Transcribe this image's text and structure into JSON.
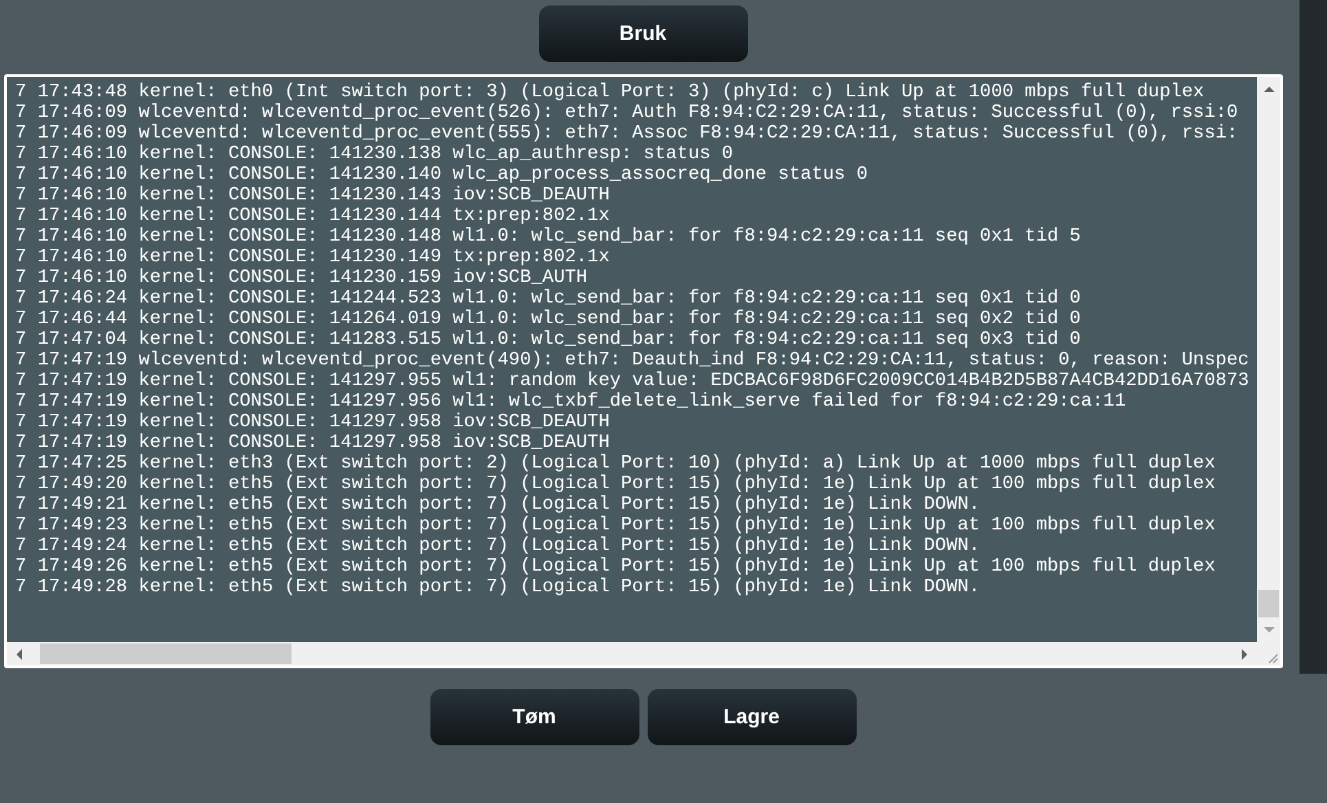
{
  "apply_button": "Bruk",
  "log_lines": [
    "7 17:43:48 kernel: eth0 (Int switch port: 3) (Logical Port: 3) (phyId: c) Link Up at 1000 mbps full duplex",
    "7 17:46:09 wlceventd: wlceventd_proc_event(526): eth7: Auth F8:94:C2:29:CA:11, status: Successful (0), rssi:0",
    "7 17:46:09 wlceventd: wlceventd_proc_event(555): eth7: Assoc F8:94:C2:29:CA:11, status: Successful (0), rssi:",
    "7 17:46:10 kernel: CONSOLE: 141230.138 wlc_ap_authresp: status 0",
    "7 17:46:10 kernel: CONSOLE: 141230.140 wlc_ap_process_assocreq_done status 0",
    "7 17:46:10 kernel: CONSOLE: 141230.143 iov:SCB_DEAUTH",
    "7 17:46:10 kernel: CONSOLE: 141230.144 tx:prep:802.1x",
    "7 17:46:10 kernel: CONSOLE: 141230.148 wl1.0: wlc_send_bar: for f8:94:c2:29:ca:11 seq 0x1 tid 5",
    "7 17:46:10 kernel: CONSOLE: 141230.149 tx:prep:802.1x",
    "7 17:46:10 kernel: CONSOLE: 141230.159 iov:SCB_AUTH",
    "7 17:46:24 kernel: CONSOLE: 141244.523 wl1.0: wlc_send_bar: for f8:94:c2:29:ca:11 seq 0x1 tid 0",
    "7 17:46:44 kernel: CONSOLE: 141264.019 wl1.0: wlc_send_bar: for f8:94:c2:29:ca:11 seq 0x2 tid 0",
    "7 17:47:04 kernel: CONSOLE: 141283.515 wl1.0: wlc_send_bar: for f8:94:c2:29:ca:11 seq 0x3 tid 0",
    "7 17:47:19 wlceventd: wlceventd_proc_event(490): eth7: Deauth_ind F8:94:C2:29:CA:11, status: 0, reason: Unspec",
    "7 17:47:19 kernel: CONSOLE: 141297.955 wl1: random key value: EDCBAC6F98D6FC2009CC014B4B2D5B87A4CB42DD16A70873",
    "7 17:47:19 kernel: CONSOLE: 141297.956 wl1: wlc_txbf_delete_link_serve failed for f8:94:c2:29:ca:11",
    "7 17:47:19 kernel: CONSOLE: 141297.958 iov:SCB_DEAUTH",
    "7 17:47:19 kernel: CONSOLE: 141297.958 iov:SCB_DEAUTH",
    "7 17:47:25 kernel: eth3 (Ext switch port: 2) (Logical Port: 10) (phyId: a) Link Up at 1000 mbps full duplex",
    "7 17:49:20 kernel: eth5 (Ext switch port: 7) (Logical Port: 15) (phyId: 1e) Link Up at 100 mbps full duplex",
    "7 17:49:21 kernel: eth5 (Ext switch port: 7) (Logical Port: 15) (phyId: 1e) Link DOWN.",
    "7 17:49:23 kernel: eth5 (Ext switch port: 7) (Logical Port: 15) (phyId: 1e) Link Up at 100 mbps full duplex",
    "7 17:49:24 kernel: eth5 (Ext switch port: 7) (Logical Port: 15) (phyId: 1e) Link DOWN.",
    "7 17:49:26 kernel: eth5 (Ext switch port: 7) (Logical Port: 15) (phyId: 1e) Link Up at 100 mbps full duplex",
    "7 17:49:28 kernel: eth5 (Ext switch port: 7) (Logical Port: 15) (phyId: 1e) Link DOWN."
  ],
  "buttons": [
    "Tøm",
    "Lagre"
  ]
}
